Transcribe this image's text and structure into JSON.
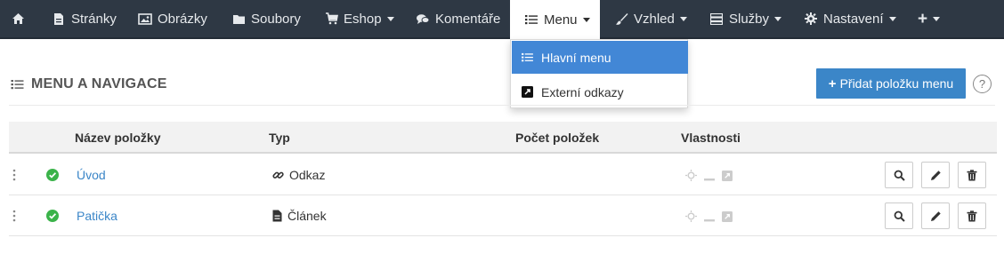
{
  "nav": {
    "home_icon": "home-icon",
    "items": [
      {
        "label": "Stránky",
        "icon": "file-icon"
      },
      {
        "label": "Obrázky",
        "icon": "image-icon"
      },
      {
        "label": "Soubory",
        "icon": "folder-icon"
      },
      {
        "label": "Eshop",
        "icon": "cart-icon"
      },
      {
        "label": "Komentáře",
        "icon": "comments-icon"
      },
      {
        "label": "Menu",
        "icon": "list-icon"
      },
      {
        "label": "Vzhled",
        "icon": "brush-icon"
      },
      {
        "label": "Služby",
        "icon": "server-icon"
      },
      {
        "label": "Nastavení",
        "icon": "gear-icon"
      }
    ],
    "plus_icon": "plus-icon"
  },
  "dropdown": {
    "items": [
      {
        "label": "Hlavní menu",
        "icon": "list-icon"
      },
      {
        "label": "Externí odkazy",
        "icon": "external-link-icon"
      }
    ]
  },
  "header": {
    "title": "MENU A NAVIGACE",
    "add_button": "Přidat položku menu",
    "help": "?"
  },
  "table": {
    "columns": [
      "Název položky",
      "Typ",
      "Počet položek",
      "Vlastnosti"
    ],
    "rows": [
      {
        "name": "Úvod",
        "type": "Odkaz",
        "type_icon": "link-icon"
      },
      {
        "name": "Patička",
        "type": "Článek",
        "type_icon": "document-icon"
      }
    ]
  },
  "colors": {
    "nav_bg": "#2e3844",
    "accent": "#3b86c8",
    "dropdown_active": "#4287d6",
    "status_ok": "#3bb34a"
  }
}
